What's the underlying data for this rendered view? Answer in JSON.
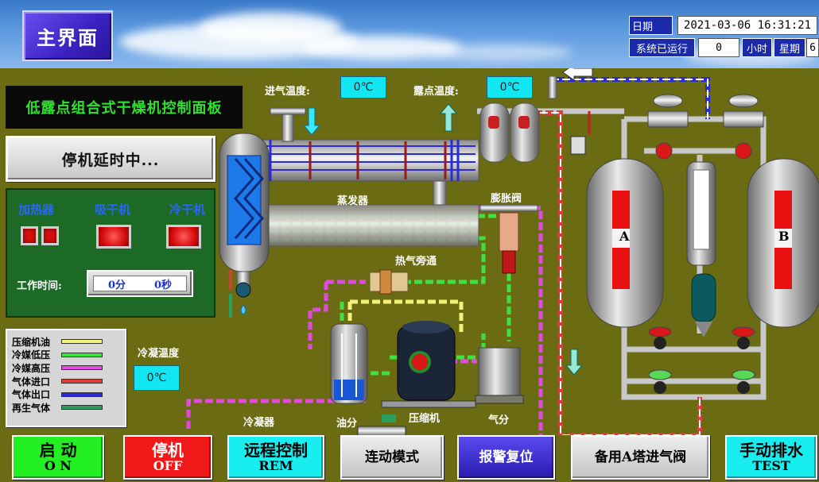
{
  "header": {
    "main_screen": "主界面",
    "date_label": "日期",
    "datetime": "2021-03-06 16:31:21",
    "runtime_label": "系统已运行",
    "runtime_value": "0",
    "hours_label": "小时",
    "weekday_label": "星期",
    "weekday_value": "6"
  },
  "panel": {
    "title": "低露点组合式干燥机控制面板",
    "status": "停机延时中...",
    "devices": {
      "heater": "加热器",
      "blower": "吸干机",
      "chiller": "冷干机"
    },
    "work_time_label": "工作时间:",
    "work_time_minutes": "0分",
    "work_time_seconds": "0秒"
  },
  "legend": [
    {
      "label": "压缩机油",
      "color": "#f2f27a"
    },
    {
      "label": "冷媒低压",
      "color": "#3ee23e"
    },
    {
      "label": "冷媒高压",
      "color": "#e04ae0"
    },
    {
      "label": "气体进口",
      "color": "#e03a3a"
    },
    {
      "label": "气体出口",
      "color": "#2a2ad8"
    },
    {
      "label": "再生气体",
      "color": "#2aa060"
    }
  ],
  "temperatures": {
    "inlet_label": "进气温度:",
    "inlet_value": "0℃",
    "dew_label": "露点温度:",
    "dew_value": "0℃",
    "cond_label": "冷凝温度",
    "cond_value": "0℃"
  },
  "components": {
    "evaporator": "蒸发器",
    "expansion_valve": "膨胀阀",
    "hot_gas_bypass": "热气旁通",
    "condenser": "冷凝器",
    "oil_separator": "油分",
    "compressor": "压缩机",
    "gas_separator": "气分",
    "tower_a": "A",
    "tower_b": "B"
  },
  "buttons": {
    "start_l1": "启  动",
    "start_l2": "O N",
    "stop_l1": "停机",
    "stop_l2": "OFF",
    "remote_l1": "远程控制",
    "remote_l2": "REM",
    "linked_mode": "连动模式",
    "alarm_reset": "报警复位",
    "tower_a_inlet": "备用A塔进气阀",
    "manual_drain_l1": "手动排水",
    "manual_drain_l2": "TEST"
  },
  "colors": {
    "background": "#6b6b14",
    "start": "#22f022",
    "stop": "#f01818",
    "remote": "#18eef0",
    "alarm": "#3a2ae0",
    "manual": "#18eef0"
  }
}
